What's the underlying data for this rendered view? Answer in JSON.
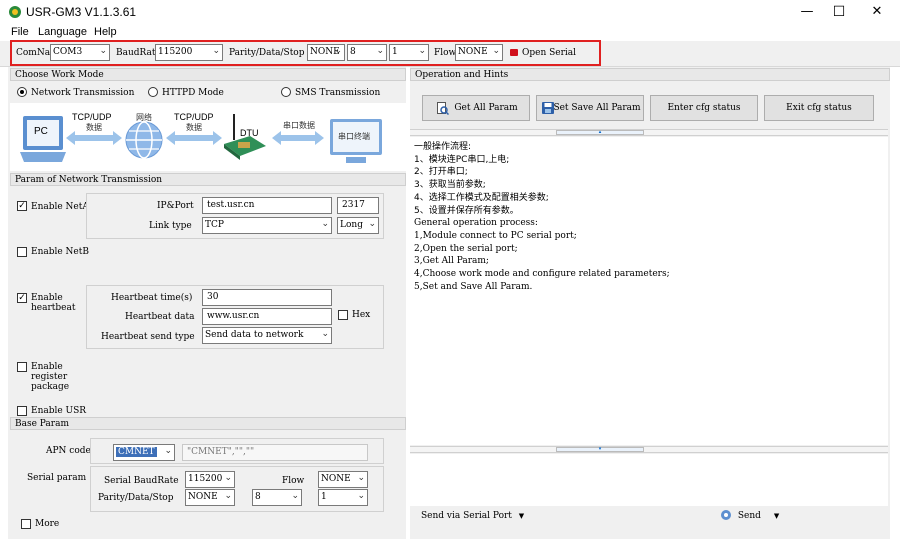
{
  "window": {
    "title": "USR-GM3 V1.1.3.61",
    "minimize": "—",
    "maximize": "☐",
    "close": "✕"
  },
  "menu": [
    "File",
    "Language",
    "Help"
  ],
  "toolbar": {
    "com_label": "ComName",
    "com_value": "COM3",
    "baud_label": "BaudRate",
    "baud_value": "115200",
    "pds_label": "Parity/Data/Stop",
    "parity_value": "NONE",
    "data_value": "8",
    "stop_value": "1",
    "flow_label": "Flow",
    "flow_value": "NONE",
    "open_label": "Open  Serial"
  },
  "work_mode": {
    "header": "Choose Work Mode",
    "opt_network": "Network Transmission",
    "opt_httpd": "HTTPD Mode",
    "opt_sms": "SMS Transmission",
    "selected": "network"
  },
  "diagram": {
    "pc": "PC",
    "tcp1": "TCP/UDP",
    "tcp1_cn": "数据",
    "net_cn": "网络",
    "tcp2": "TCP/UDP",
    "tcp2_cn": "数据",
    "dtu": "DTU",
    "serial_cn": "串口数据",
    "terminal_cn": "串口终端"
  },
  "network_param": {
    "header": "Param of Network Transmission",
    "enable_neta": "Enable NetA",
    "ip_label": "IP&Port",
    "ip_value": "test.usr.cn",
    "port_value": "2317",
    "link_label": "Link type",
    "link_value": "TCP",
    "conn_value": "Long",
    "enable_netb": "Enable NetB",
    "enable_heartbeat": "Enable heartbeat",
    "hb_time_label": "Heartbeat time(s)",
    "hb_time_value": "30",
    "hb_data_label": "Heartbeat data",
    "hb_data_value": "www.usr.cn",
    "hex_label": "Hex",
    "hb_send_label": "Heartbeat send type",
    "hb_send_value": "Send data to network",
    "enable_register": "Enable register package",
    "enable_usr": "Enable USR"
  },
  "base_param": {
    "header": "Base Param",
    "apn_label": "APN code",
    "apn_value": "CMNET",
    "apn_full": "\"CMNET\",\"\",\"\"",
    "serial_label": "Serial param",
    "serial_baud_label": "Serial BaudRate",
    "serial_baud_value": "115200",
    "flow_label": "Flow",
    "flow_value": "NONE",
    "pds_label": "Parity/Data/Stop",
    "parity_value": "NONE",
    "data_value": "8",
    "stop_value": "1",
    "more_label": "More"
  },
  "right_panel": {
    "header": "Operation and Hints",
    "btn_get": "Get All Param",
    "btn_save": "Set Save All Param",
    "btn_enter": "Enter cfg status",
    "btn_exit": "Exit cfg status",
    "log": [
      "一般操作流程:",
      "1、模块连PC串口,上电;",
      "2、打开串口;",
      "3、获取当前参数;",
      "4、选择工作模式及配置相关参数;",
      "5、设置并保存所有参数。",
      "General operation process:",
      "1,Module connect to PC serial port;",
      "2,Open the serial port;",
      "3,Get All Param;",
      "4,Choose work mode and configure related parameters;",
      "5,Set and Save All Param."
    ],
    "send_via": "Send via Serial Port",
    "send_label": "Send"
  },
  "colors": {
    "highlight_border": "#e02020",
    "open_indicator": "#d0101c",
    "selection_blue": "#3d6fb8"
  }
}
